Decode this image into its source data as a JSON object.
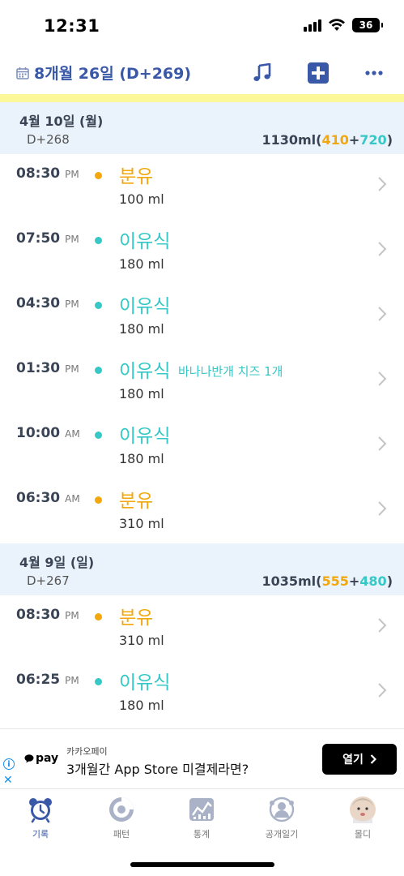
{
  "status_bar": {
    "time": "12:31",
    "battery": "36"
  },
  "header": {
    "title": "8개월 26일 (D+269)",
    "icons": [
      "calendar-icon",
      "music-note-icon",
      "add-square-icon",
      "more-icon"
    ]
  },
  "colors": {
    "primary": "#3a58a8",
    "formula": "#f2a70c",
    "solid": "#36c8c6",
    "day_header_bg": "#eaf3fb",
    "top_band": "#fcf89a"
  },
  "days": [
    {
      "date": "4월 10일 (월)",
      "dplus": "D+268",
      "total": "1130ml",
      "formula_amount": "410",
      "solid_amount": "720",
      "entries": [
        {
          "time": "08:30",
          "ampm": "PM",
          "type": "분유",
          "kind": "formula",
          "amount": "100 ml",
          "note": ""
        },
        {
          "time": "07:50",
          "ampm": "PM",
          "type": "이유식",
          "kind": "solid",
          "amount": "180 ml",
          "note": ""
        },
        {
          "time": "04:30",
          "ampm": "PM",
          "type": "이유식",
          "kind": "solid",
          "amount": "180 ml",
          "note": ""
        },
        {
          "time": "01:30",
          "ampm": "PM",
          "type": "이유식",
          "kind": "solid",
          "amount": "180 ml",
          "note": "바나나반개 치즈 1개"
        },
        {
          "time": "10:00",
          "ampm": "AM",
          "type": "이유식",
          "kind": "solid",
          "amount": "180 ml",
          "note": ""
        },
        {
          "time": "06:30",
          "ampm": "AM",
          "type": "분유",
          "kind": "formula",
          "amount": "310 ml",
          "note": ""
        }
      ]
    },
    {
      "date": "4월 9일 (일)",
      "dplus": "D+267",
      "total": "1035ml",
      "formula_amount": "555",
      "solid_amount": "480",
      "entries": [
        {
          "time": "08:30",
          "ampm": "PM",
          "type": "분유",
          "kind": "formula",
          "amount": "310 ml",
          "note": ""
        },
        {
          "time": "06:25",
          "ampm": "PM",
          "type": "이유식",
          "kind": "solid",
          "amount": "180 ml",
          "note": ""
        }
      ]
    }
  ],
  "ad": {
    "logo": "pay",
    "brand": "카카오페이",
    "text": "3개월간 App Store 미결제라면?",
    "button": "열기"
  },
  "tabs": [
    {
      "label": "기록",
      "icon": "alarm-clock-icon",
      "active": true
    },
    {
      "label": "패턴",
      "icon": "pattern-chart-icon",
      "active": false
    },
    {
      "label": "통계",
      "icon": "statistics-icon",
      "active": false
    },
    {
      "label": "공개일기",
      "icon": "public-diary-icon",
      "active": false
    },
    {
      "label": "몰디",
      "icon": "profile-avatar-icon",
      "active": false
    }
  ]
}
